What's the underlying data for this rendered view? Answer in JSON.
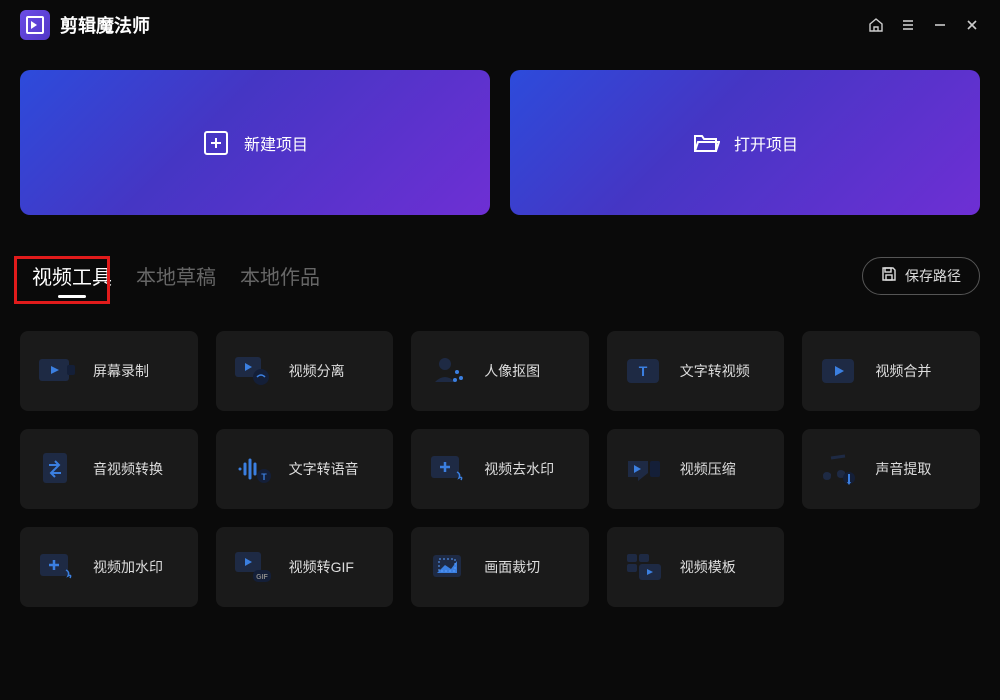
{
  "app": {
    "title": "剪辑魔法师"
  },
  "mainActions": {
    "newProject": "新建项目",
    "openProject": "打开项目"
  },
  "tabs": {
    "videoTools": "视频工具",
    "localDrafts": "本地草稿",
    "localWorks": "本地作品"
  },
  "savePath": "保存路径",
  "tools": [
    {
      "label": "屏幕录制",
      "icon": "screen-record"
    },
    {
      "label": "视频分离",
      "icon": "video-separate"
    },
    {
      "label": "人像抠图",
      "icon": "portrait-matting"
    },
    {
      "label": "文字转视频",
      "icon": "text-to-video"
    },
    {
      "label": "视频合并",
      "icon": "video-merge"
    },
    {
      "label": "音视频转换",
      "icon": "av-convert"
    },
    {
      "label": "文字转语音",
      "icon": "text-to-speech"
    },
    {
      "label": "视频去水印",
      "icon": "remove-watermark"
    },
    {
      "label": "视频压缩",
      "icon": "video-compress"
    },
    {
      "label": "声音提取",
      "icon": "audio-extract"
    },
    {
      "label": "视频加水印",
      "icon": "add-watermark"
    },
    {
      "label": "视频转GIF",
      "icon": "video-to-gif"
    },
    {
      "label": "画面裁切",
      "icon": "crop"
    },
    {
      "label": "视频模板",
      "icon": "video-template"
    }
  ]
}
